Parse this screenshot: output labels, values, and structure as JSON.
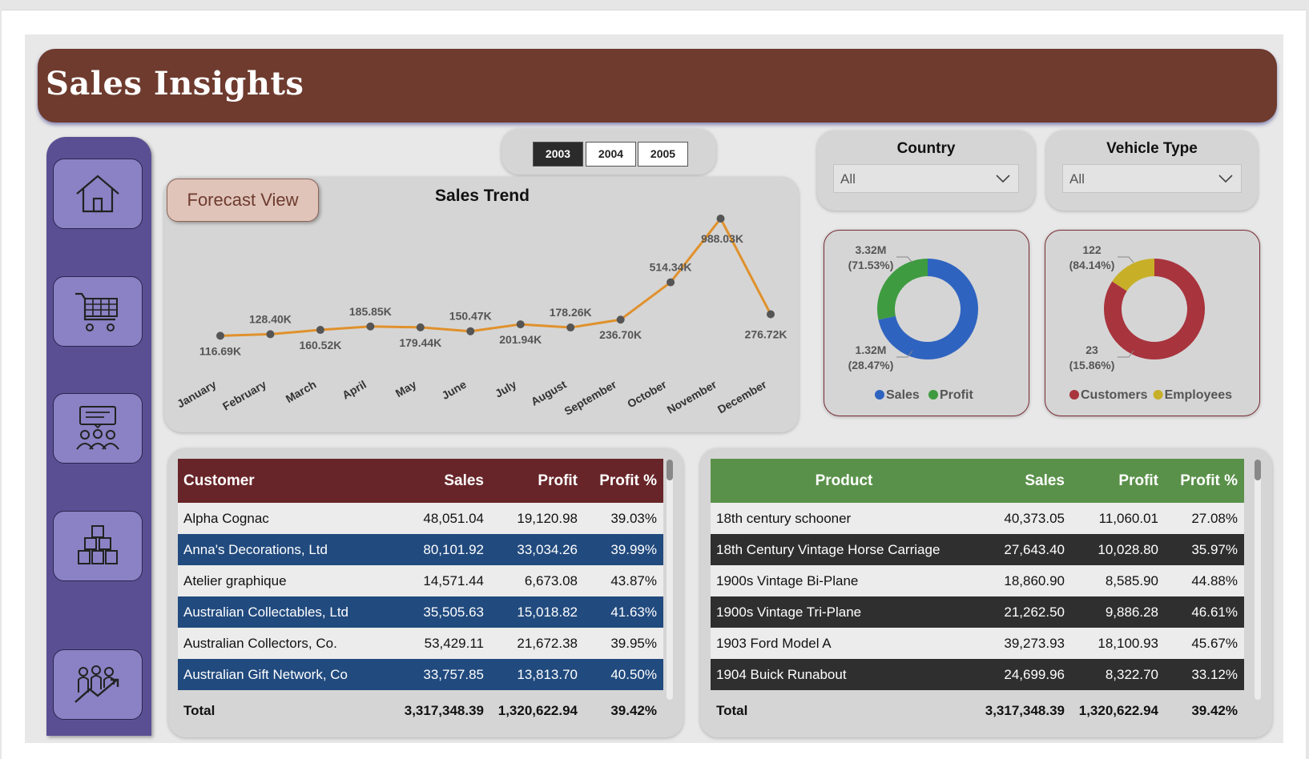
{
  "banner": {
    "title": "Sales Insights"
  },
  "nav": [
    {
      "icon": "home-icon"
    },
    {
      "icon": "shopping-cart-icon"
    },
    {
      "icon": "presentation-team-icon"
    },
    {
      "icon": "boxes-icon"
    },
    {
      "icon": "people-growth-icon"
    }
  ],
  "year_slicer": {
    "years": [
      "2003",
      "2004",
      "2005"
    ],
    "selected": "2003"
  },
  "forecast": {
    "label": "Forecast View"
  },
  "filters": {
    "country": {
      "label": "Country",
      "value": "All"
    },
    "vehicle": {
      "label": "Vehicle Type",
      "value": "All"
    }
  },
  "colors": {
    "banner": "#6e3b2e",
    "sidebar": "#5b4f94",
    "nav_button": "#8a82c4",
    "trend_line": "#e0912c",
    "sales": "#2f63c0",
    "profit": "#3e9b40",
    "customers": "#a8343d",
    "employees": "#c7b028",
    "customer_header": "#682529",
    "customer_stripe": "#214a7e",
    "product_header": "#5a914a",
    "product_stripe": "#2f2f2f"
  },
  "chart_data": [
    {
      "type": "line",
      "title": "Sales Trend",
      "x": [
        "January",
        "February",
        "March",
        "April",
        "May",
        "June",
        "July",
        "August",
        "September",
        "October",
        "November",
        "December"
      ],
      "values": [
        116690,
        128400,
        160520,
        185850,
        179440,
        150470,
        201940,
        178260,
        236700,
        514340,
        988030,
        276720
      ],
      "data_labels": [
        "116.69K",
        "128.40K",
        "160.52K",
        "185.85K",
        "179.44K",
        "150.47K",
        "201.94K",
        "178.26K",
        "236.70K",
        "514.34K",
        "988.03K",
        "276.72K"
      ],
      "grid": false
    },
    {
      "type": "pie",
      "categories": [
        "Sales",
        "Profit"
      ],
      "values": [
        3317348.39,
        1320622.94
      ],
      "percent": [
        71.53,
        28.47
      ],
      "value_labels": [
        "3.32M",
        "1.32M"
      ],
      "percent_labels": [
        "(71.53%)",
        "(28.47%)"
      ],
      "legend": "bottom"
    },
    {
      "type": "pie",
      "categories": [
        "Customers",
        "Employees"
      ],
      "values": [
        122,
        23
      ],
      "percent": [
        84.14,
        15.86
      ],
      "value_labels": [
        "122",
        "23"
      ],
      "percent_labels": [
        "(84.14%)",
        "(15.86%)"
      ],
      "legend": "bottom"
    }
  ],
  "customer_table": {
    "headers": [
      "Customer",
      "Sales",
      "Profit",
      "Profit %"
    ],
    "rows": [
      [
        "Alpha Cognac",
        "48,051.04",
        "19,120.98",
        "39.03%"
      ],
      [
        "Anna's Decorations, Ltd",
        "80,101.92",
        "33,034.26",
        "39.99%"
      ],
      [
        "Atelier graphique",
        "14,571.44",
        "6,673.08",
        "43.87%"
      ],
      [
        "Australian Collectables, Ltd",
        "35,505.63",
        "15,018.82",
        "41.63%"
      ],
      [
        "Australian Collectors, Co.",
        "53,429.11",
        "21,672.38",
        "39.95%"
      ],
      [
        "Australian Gift Network, Co",
        "33,757.85",
        "13,813.70",
        "40.50%"
      ]
    ],
    "total": [
      "Total",
      "3,317,348.39",
      "1,320,622.94",
      "39.42%"
    ]
  },
  "product_table": {
    "headers": [
      "Product",
      "Sales",
      "Profit",
      "Profit %"
    ],
    "rows": [
      [
        "18th century schooner",
        "40,373.05",
        "11,060.01",
        "27.08%"
      ],
      [
        "18th Century Vintage Horse Carriage",
        "27,643.40",
        "10,028.80",
        "35.97%"
      ],
      [
        "1900s Vintage Bi-Plane",
        "18,860.90",
        "8,585.90",
        "44.88%"
      ],
      [
        "1900s Vintage Tri-Plane",
        "21,262.50",
        "9,886.28",
        "46.61%"
      ],
      [
        "1903 Ford Model A",
        "39,273.93",
        "18,100.93",
        "45.67%"
      ],
      [
        "1904 Buick Runabout",
        "24,699.96",
        "8,322.70",
        "33.12%"
      ]
    ],
    "total": [
      "Total",
      "3,317,348.39",
      "1,320,622.94",
      "39.42%"
    ]
  }
}
